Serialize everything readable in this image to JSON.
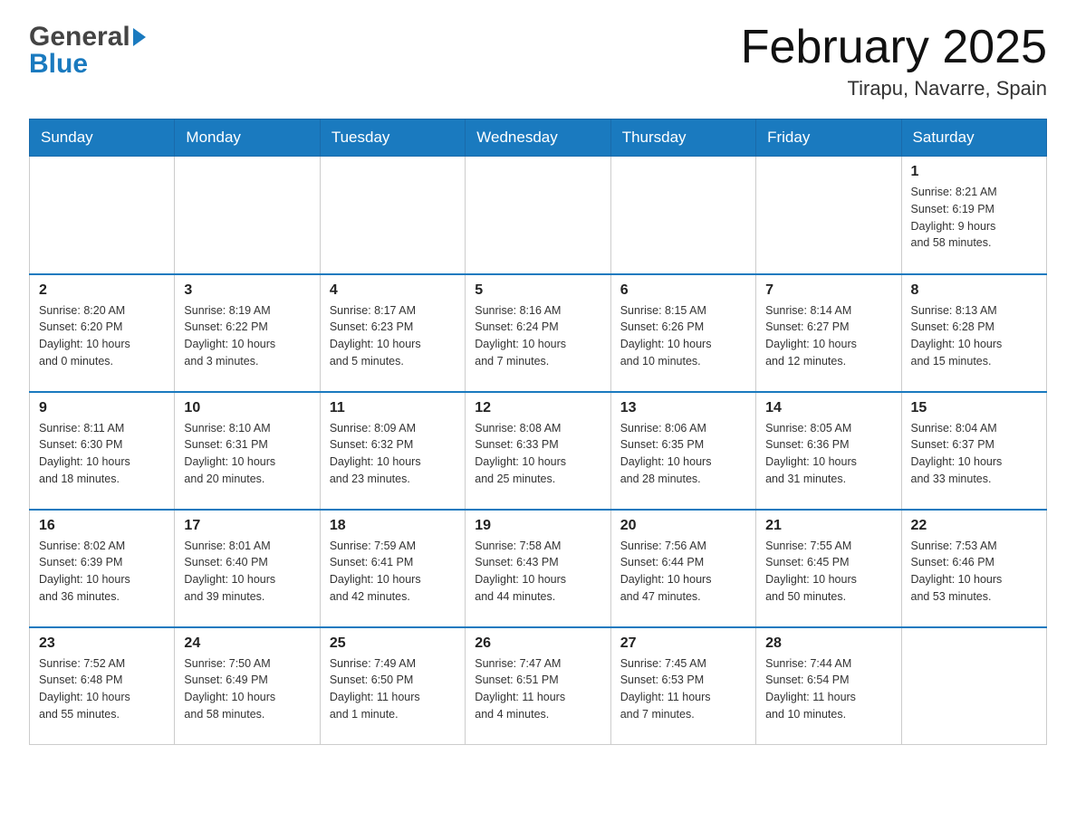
{
  "header": {
    "logo_general": "General",
    "logo_blue": "Blue",
    "month_title": "February 2025",
    "location": "Tirapu, Navarre, Spain"
  },
  "weekdays": [
    "Sunday",
    "Monday",
    "Tuesday",
    "Wednesday",
    "Thursday",
    "Friday",
    "Saturday"
  ],
  "weeks": [
    [
      {
        "day": "",
        "info": ""
      },
      {
        "day": "",
        "info": ""
      },
      {
        "day": "",
        "info": ""
      },
      {
        "day": "",
        "info": ""
      },
      {
        "day": "",
        "info": ""
      },
      {
        "day": "",
        "info": ""
      },
      {
        "day": "1",
        "info": "Sunrise: 8:21 AM\nSunset: 6:19 PM\nDaylight: 9 hours\nand 58 minutes."
      }
    ],
    [
      {
        "day": "2",
        "info": "Sunrise: 8:20 AM\nSunset: 6:20 PM\nDaylight: 10 hours\nand 0 minutes."
      },
      {
        "day": "3",
        "info": "Sunrise: 8:19 AM\nSunset: 6:22 PM\nDaylight: 10 hours\nand 3 minutes."
      },
      {
        "day": "4",
        "info": "Sunrise: 8:17 AM\nSunset: 6:23 PM\nDaylight: 10 hours\nand 5 minutes."
      },
      {
        "day": "5",
        "info": "Sunrise: 8:16 AM\nSunset: 6:24 PM\nDaylight: 10 hours\nand 7 minutes."
      },
      {
        "day": "6",
        "info": "Sunrise: 8:15 AM\nSunset: 6:26 PM\nDaylight: 10 hours\nand 10 minutes."
      },
      {
        "day": "7",
        "info": "Sunrise: 8:14 AM\nSunset: 6:27 PM\nDaylight: 10 hours\nand 12 minutes."
      },
      {
        "day": "8",
        "info": "Sunrise: 8:13 AM\nSunset: 6:28 PM\nDaylight: 10 hours\nand 15 minutes."
      }
    ],
    [
      {
        "day": "9",
        "info": "Sunrise: 8:11 AM\nSunset: 6:30 PM\nDaylight: 10 hours\nand 18 minutes."
      },
      {
        "day": "10",
        "info": "Sunrise: 8:10 AM\nSunset: 6:31 PM\nDaylight: 10 hours\nand 20 minutes."
      },
      {
        "day": "11",
        "info": "Sunrise: 8:09 AM\nSunset: 6:32 PM\nDaylight: 10 hours\nand 23 minutes."
      },
      {
        "day": "12",
        "info": "Sunrise: 8:08 AM\nSunset: 6:33 PM\nDaylight: 10 hours\nand 25 minutes."
      },
      {
        "day": "13",
        "info": "Sunrise: 8:06 AM\nSunset: 6:35 PM\nDaylight: 10 hours\nand 28 minutes."
      },
      {
        "day": "14",
        "info": "Sunrise: 8:05 AM\nSunset: 6:36 PM\nDaylight: 10 hours\nand 31 minutes."
      },
      {
        "day": "15",
        "info": "Sunrise: 8:04 AM\nSunset: 6:37 PM\nDaylight: 10 hours\nand 33 minutes."
      }
    ],
    [
      {
        "day": "16",
        "info": "Sunrise: 8:02 AM\nSunset: 6:39 PM\nDaylight: 10 hours\nand 36 minutes."
      },
      {
        "day": "17",
        "info": "Sunrise: 8:01 AM\nSunset: 6:40 PM\nDaylight: 10 hours\nand 39 minutes."
      },
      {
        "day": "18",
        "info": "Sunrise: 7:59 AM\nSunset: 6:41 PM\nDaylight: 10 hours\nand 42 minutes."
      },
      {
        "day": "19",
        "info": "Sunrise: 7:58 AM\nSunset: 6:43 PM\nDaylight: 10 hours\nand 44 minutes."
      },
      {
        "day": "20",
        "info": "Sunrise: 7:56 AM\nSunset: 6:44 PM\nDaylight: 10 hours\nand 47 minutes."
      },
      {
        "day": "21",
        "info": "Sunrise: 7:55 AM\nSunset: 6:45 PM\nDaylight: 10 hours\nand 50 minutes."
      },
      {
        "day": "22",
        "info": "Sunrise: 7:53 AM\nSunset: 6:46 PM\nDaylight: 10 hours\nand 53 minutes."
      }
    ],
    [
      {
        "day": "23",
        "info": "Sunrise: 7:52 AM\nSunset: 6:48 PM\nDaylight: 10 hours\nand 55 minutes."
      },
      {
        "day": "24",
        "info": "Sunrise: 7:50 AM\nSunset: 6:49 PM\nDaylight: 10 hours\nand 58 minutes."
      },
      {
        "day": "25",
        "info": "Sunrise: 7:49 AM\nSunset: 6:50 PM\nDaylight: 11 hours\nand 1 minute."
      },
      {
        "day": "26",
        "info": "Sunrise: 7:47 AM\nSunset: 6:51 PM\nDaylight: 11 hours\nand 4 minutes."
      },
      {
        "day": "27",
        "info": "Sunrise: 7:45 AM\nSunset: 6:53 PM\nDaylight: 11 hours\nand 7 minutes."
      },
      {
        "day": "28",
        "info": "Sunrise: 7:44 AM\nSunset: 6:54 PM\nDaylight: 11 hours\nand 10 minutes."
      },
      {
        "day": "",
        "info": ""
      }
    ]
  ]
}
